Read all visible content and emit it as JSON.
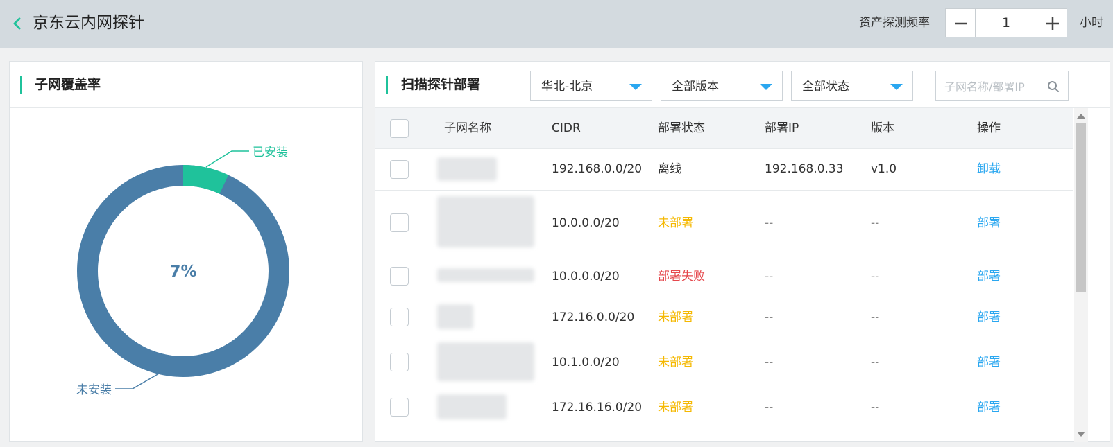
{
  "header": {
    "title": "京东云内网探针",
    "freq_label": "资产探测频率",
    "freq_value": "1",
    "unit": "小时"
  },
  "coverage": {
    "title": "子网覆盖率",
    "percent_label": "7%",
    "installed_label": "已安装",
    "uninstalled_label": "未安装",
    "installed_fraction": 0.07,
    "colors": {
      "installed": "#1fc29b",
      "uninstalled": "#4a7ea8"
    }
  },
  "deploy": {
    "title": "扫描探针部署",
    "filters": {
      "region": "华北-北京",
      "version": "全部版本",
      "status": "全部状态",
      "search_placeholder": "子网名称/部署IP"
    },
    "columns": {
      "name": "子网名称",
      "cidr": "CIDR",
      "status": "部署状态",
      "ip": "部署IP",
      "version": "版本",
      "action": "操作"
    },
    "rows": [
      {
        "cidr": "192.168.0.0/20",
        "status": "离线",
        "status_color": "#333333",
        "ip": "192.168.0.33",
        "version": "v1.0",
        "action": "卸载"
      },
      {
        "cidr": "10.0.0.0/20",
        "status": "未部署",
        "status_color": "#f5b800",
        "ip": "--",
        "version": "--",
        "action": "部署"
      },
      {
        "cidr": "10.0.0.0/20",
        "status": "部署失败",
        "status_color": "#e5484d",
        "ip": "--",
        "version": "--",
        "action": "部署"
      },
      {
        "cidr": "172.16.0.0/20",
        "status": "未部署",
        "status_color": "#f5b800",
        "ip": "--",
        "version": "--",
        "action": "部署"
      },
      {
        "cidr": "10.1.0.0/20",
        "status": "未部署",
        "status_color": "#f5b800",
        "ip": "--",
        "version": "--",
        "action": "部署"
      },
      {
        "cidr": "172.16.16.0/20",
        "status": "未部署",
        "status_color": "#f5b800",
        "ip": "--",
        "version": "--",
        "action": "部署"
      }
    ]
  }
}
